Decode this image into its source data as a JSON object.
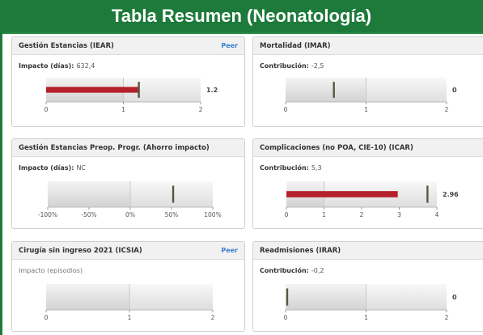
{
  "banner_title": "Tabla Resumen (Neonatología)",
  "colors": {
    "brand_green": "#1e7a3a",
    "bar_red": "#b5202b",
    "marker": "#555a3f",
    "peer_link": "#3a7fd0"
  },
  "cards": [
    {
      "title": "Gestión Estancias (IEAR)",
      "peer": "Peer",
      "metric_label": "Impacto (días):",
      "metric_value": "632,4",
      "chart": {
        "min": 0,
        "max": 2,
        "band_split": 1,
        "bar": 1.2,
        "marker": 1.2,
        "value_label": "1.2",
        "ticks": [
          {
            "v": 0,
            "label": "0"
          },
          {
            "v": 1,
            "label": "1"
          },
          {
            "v": 2,
            "label": "2"
          }
        ]
      }
    },
    {
      "title": "Mortalidad (IMAR)",
      "peer": "",
      "metric_label": "Contribución:",
      "metric_value": "-2,5",
      "chart": {
        "min": 0,
        "max": 2,
        "band_split": 1,
        "bar": 0,
        "marker": 0.6,
        "value_label": "0",
        "ticks": [
          {
            "v": 0,
            "label": "0"
          },
          {
            "v": 1,
            "label": "1"
          },
          {
            "v": 2,
            "label": "2"
          }
        ]
      }
    },
    {
      "title": "Gestión Estancias Preop. Progr. (Ahorro impacto)",
      "peer": "",
      "metric_label": "Impacto (días):",
      "metric_value": "NC",
      "chart": {
        "min": -100,
        "max": 100,
        "band_split": 0,
        "bar": 0,
        "marker": 52,
        "value_label": "",
        "ticks": [
          {
            "v": -100,
            "label": "-100%"
          },
          {
            "v": -50,
            "label": "-50%"
          },
          {
            "v": 0,
            "label": "0%"
          },
          {
            "v": 50,
            "label": "50%"
          },
          {
            "v": 100,
            "label": "100%"
          }
        ]
      }
    },
    {
      "title": "Complicaciones (no POA, CIE-10) (ICAR)",
      "peer": "",
      "metric_label": "Contribución:",
      "metric_value": "5,3",
      "chart": {
        "min": 0,
        "max": 4,
        "band_split": 1,
        "bar": 2.96,
        "marker": 3.75,
        "value_label": "2.96",
        "ticks": [
          {
            "v": 0,
            "label": "0"
          },
          {
            "v": 1,
            "label": "1"
          },
          {
            "v": 2,
            "label": "2"
          },
          {
            "v": 3,
            "label": "3"
          },
          {
            "v": 4,
            "label": "4"
          }
        ]
      }
    },
    {
      "title": "Cirugía sin ingreso 2021 (ICSIA)",
      "peer": "Peer",
      "metric_label": "Impacto (episodios)",
      "metric_value": "",
      "chart": {
        "min": 0,
        "max": 2,
        "band_split": 1,
        "bar": 0,
        "marker": null,
        "value_label": "",
        "ticks": [
          {
            "v": 0,
            "label": "0"
          },
          {
            "v": 1,
            "label": "1"
          },
          {
            "v": 2,
            "label": "2"
          }
        ]
      }
    },
    {
      "title": "Readmisiones (IRAR)",
      "peer": "",
      "metric_label": "Contribución:",
      "metric_value": "-0,2",
      "chart": {
        "min": 0,
        "max": 2,
        "band_split": 1,
        "bar": 0,
        "marker": 0.02,
        "value_label": "0",
        "ticks": [
          {
            "v": 0,
            "label": "0"
          },
          {
            "v": 1,
            "label": "1"
          },
          {
            "v": 2,
            "label": "2"
          }
        ]
      }
    }
  ]
}
